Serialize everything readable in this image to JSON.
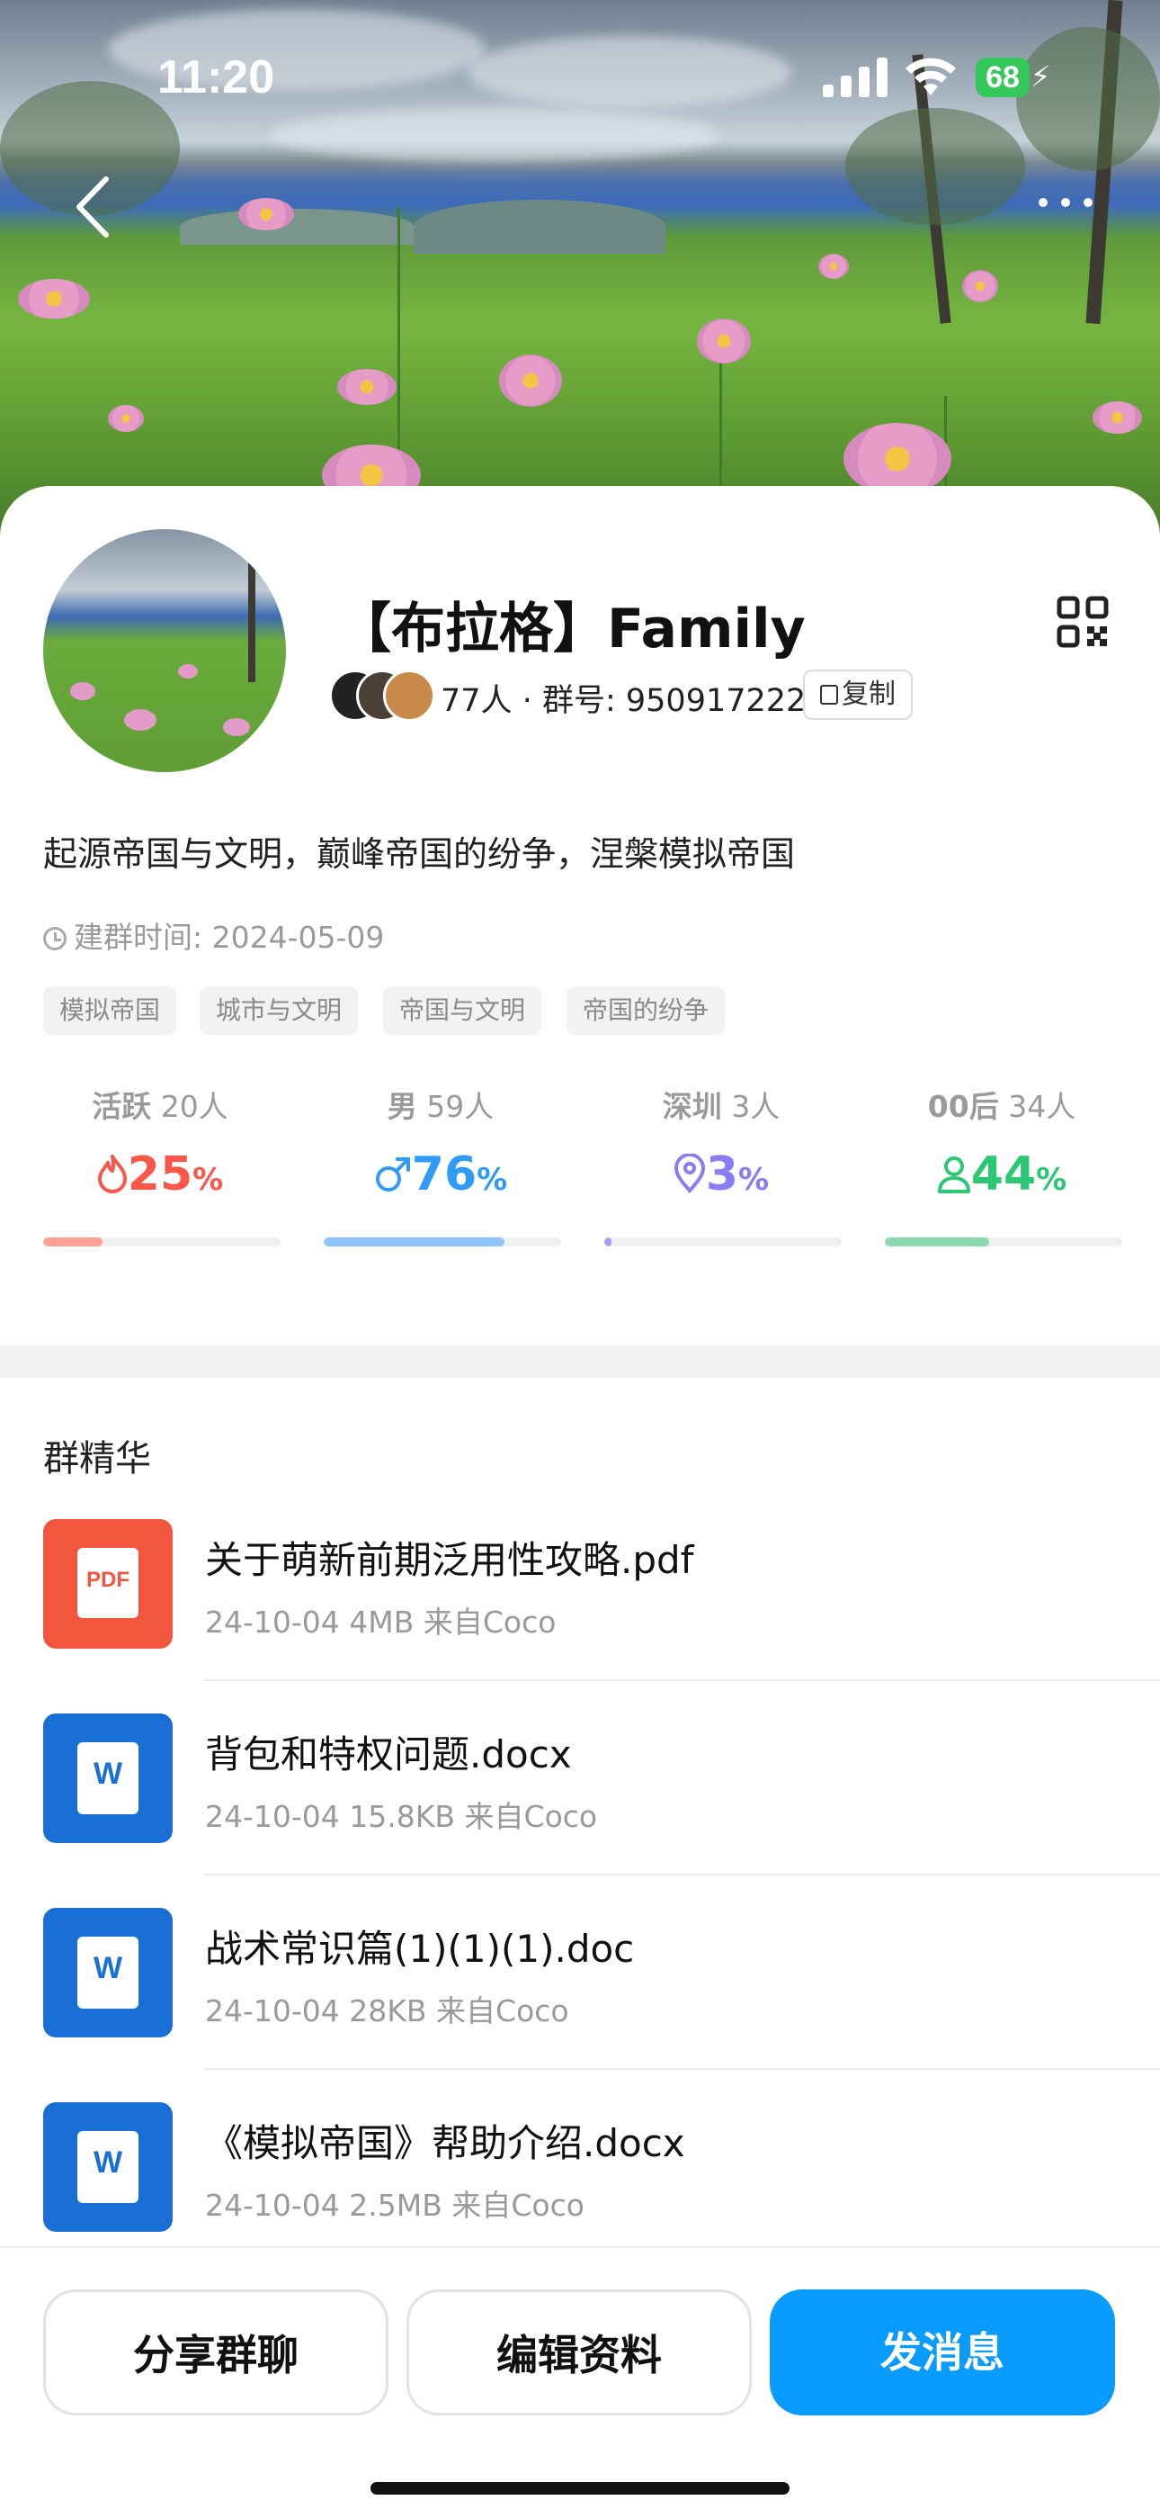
{
  "status_bar": {
    "time": "11:20",
    "battery": "68"
  },
  "header": {
    "back_icon": "chevron-left-icon",
    "more_icon": "more-dots-icon"
  },
  "group": {
    "name": "【布拉格】Family",
    "members": "77人",
    "group_number_label": "群号:",
    "group_number": "950917222",
    "copy_label": "复制",
    "description": "起源帝国与文明，巅峰帝国的纷争，涅槃模拟帝国",
    "created_label": "建群时间:",
    "created_date": "2024-05-09",
    "tags": [
      "模拟帝国",
      "城市与文明",
      "帝国与文明",
      "帝国的纷争"
    ]
  },
  "stats": [
    {
      "label": "活跃",
      "count": "20人",
      "pct": "25",
      "unit": "%",
      "fraction": 0.25,
      "color": "#f8574a",
      "track": "#ff9f95",
      "icon": "flame-icon"
    },
    {
      "label": "男",
      "count": "59人",
      "pct": "76",
      "unit": "%",
      "fraction": 0.76,
      "color": "#2f9bf6",
      "track": "#8fc3fb",
      "icon": "male-icon"
    },
    {
      "label": "深圳",
      "count": "3人",
      "pct": "3",
      "unit": "%",
      "fraction": 0.03,
      "color": "#8a7cf4",
      "track": "#a99ff5",
      "icon": "location-pin-icon"
    },
    {
      "label": "00后",
      "count": "34人",
      "pct": "44",
      "unit": "%",
      "fraction": 0.44,
      "color": "#2cc775",
      "track": "#8ed8ae",
      "icon": "person-icon"
    }
  ],
  "essence": {
    "title": "群精华",
    "files": [
      {
        "name": "关于萌新前期泛用性攻略.pdf",
        "meta": "24-10-04  4MB  来自Coco",
        "type": "PDF",
        "icon": "pdf-file-icon"
      },
      {
        "name": "背包和特权问题.docx",
        "meta": "24-10-04  15.8KB  来自Coco",
        "type": "W",
        "icon": "word-file-icon"
      },
      {
        "name": "战术常识篇(1)(1)(1).doc",
        "meta": "24-10-04  28KB  来自Coco",
        "type": "W",
        "icon": "word-file-icon"
      },
      {
        "name": "《模拟帝国》帮助介绍.docx",
        "meta": "24-10-04  2.5MB  来自Coco",
        "type": "W",
        "icon": "word-file-icon"
      }
    ]
  },
  "actions": {
    "share": "分享群聊",
    "edit": "编辑资料",
    "send": "发消息"
  },
  "colors": {
    "primary": "#0a9bff",
    "pdf": "#f2573d",
    "word": "#1a6fd6"
  }
}
